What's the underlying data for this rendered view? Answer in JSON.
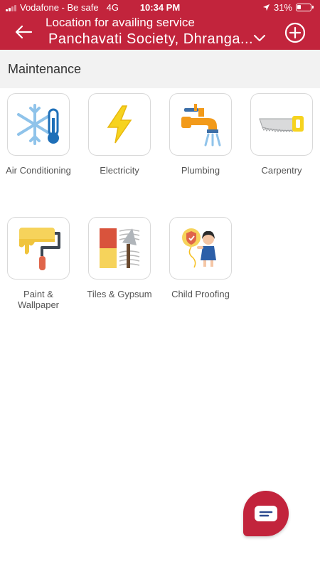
{
  "status_bar": {
    "carrier": "Vodafone - Be safe",
    "network": "4G",
    "time": "10:34 PM",
    "battery": "31%"
  },
  "header": {
    "location_label": "Location for availing service",
    "location_value": "Panchavati Society,  Dhranga..."
  },
  "section": {
    "title": "Maintenance"
  },
  "services": [
    {
      "label": "Air Conditioning",
      "icon": "snowflake-thermometer-icon"
    },
    {
      "label": "Electricity",
      "icon": "lightning-icon"
    },
    {
      "label": "Plumbing",
      "icon": "tap-icon"
    },
    {
      "label": "Carpentry",
      "icon": "saw-icon"
    },
    {
      "label": "Paint & Wallpaper",
      "icon": "paint-roller-icon"
    },
    {
      "label": "Tiles & Gypsum",
      "icon": "tiles-trowel-icon"
    },
    {
      "label": "Child Proofing",
      "icon": "child-shield-icon"
    }
  ],
  "colors": {
    "brand": "#c2243c",
    "section_bg": "#f2f2f2"
  }
}
